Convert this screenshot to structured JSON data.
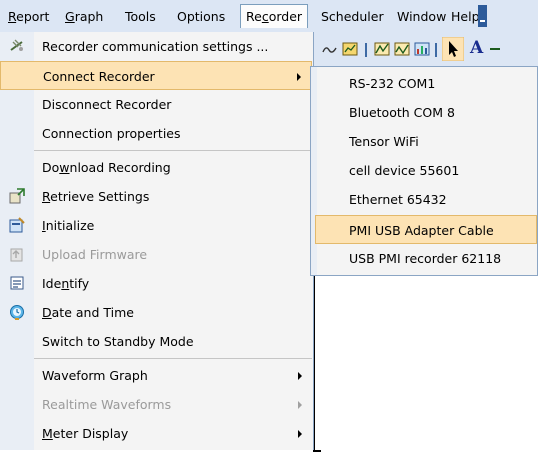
{
  "menubar": {
    "items": [
      {
        "label": "Report",
        "mnemonic": "R"
      },
      {
        "label": "Graph",
        "mnemonic": "G"
      },
      {
        "label": "Tools"
      },
      {
        "label": "Options"
      },
      {
        "label": "Recorder",
        "mnemonic": "c"
      },
      {
        "label": "Scheduler"
      },
      {
        "label": "Window"
      },
      {
        "label": "Help"
      }
    ]
  },
  "toolbar": {
    "icons": [
      "curve-icon",
      "chart-icon",
      "graph-icon",
      "graph-icon",
      "meter-icon",
      "pointer-icon",
      "text-icon"
    ],
    "text_tool": "A"
  },
  "recorder_menu": {
    "items": [
      {
        "label": "Recorder communication settings ...",
        "icon": "antenna-icon"
      },
      {
        "label": "Connect Recorder",
        "submenu": true,
        "highlighted": true
      },
      {
        "label": "Disconnect Recorder"
      },
      {
        "label": "Connection properties"
      },
      {
        "label": "Download Recording",
        "mnemonic": "w"
      },
      {
        "label": "Retrieve Settings",
        "mnemonic": "R",
        "icon": "retrieve-icon"
      },
      {
        "label": "Initialize",
        "mnemonic": "I",
        "icon": "initialize-icon"
      },
      {
        "label": "Upload Firmware",
        "disabled": true,
        "icon": "upload-icon"
      },
      {
        "label": "Identify",
        "mnemonic": "n",
        "icon": "identify-icon"
      },
      {
        "label": "Date and Time",
        "mnemonic": "D",
        "icon": "clock-icon"
      },
      {
        "label": "Switch to Standby Mode"
      },
      {
        "label": "Waveform Graph",
        "submenu": true
      },
      {
        "label": "Realtime Waveforms",
        "submenu": true,
        "disabled": true
      },
      {
        "label": "Meter Display",
        "mnemonic": "M",
        "submenu": true
      }
    ]
  },
  "connect_submenu": {
    "items": [
      {
        "label": "RS-232 COM1"
      },
      {
        "label": "Bluetooth COM 8"
      },
      {
        "label": "Tensor WiFi"
      },
      {
        "label": "cell device 55601"
      },
      {
        "label": "Ethernet 65432"
      },
      {
        "label": "PMI USB Adapter Cable",
        "highlighted": true
      },
      {
        "label": "USB PMI recorder 62118"
      }
    ]
  },
  "colors": {
    "menubar_bg": "#dce6f4",
    "menu_bg": "#f4f4f4",
    "highlight_bg": "#fde3b4",
    "highlight_border": "#e3b96b",
    "disabled_text": "#9a9a9a"
  }
}
